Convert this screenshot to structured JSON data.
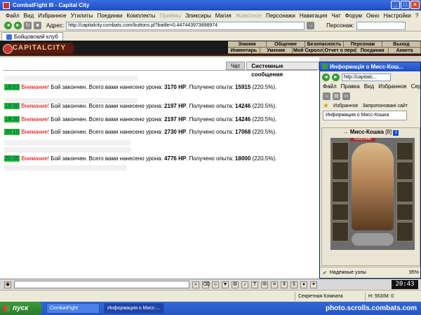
{
  "window": {
    "title": "CombatFight III - Capital City"
  },
  "menu": [
    "Файл",
    "Вид",
    "Избранное",
    "Утилиты",
    "Поединки",
    "Комплекты",
    "Приёмы",
    "Эликсиры",
    "Магия",
    "Животное",
    "Персонажи",
    "Навигация",
    "Чат",
    "Форум",
    "Окно",
    "Настройки",
    "?"
  ],
  "address": {
    "label": "Адрес:",
    "url": "http://capitalcity.combats.com/buttons.pl?battle=0.447443973898974",
    "persona_label": "Персонаж:"
  },
  "tab": {
    "label": "Бойцовский клуб"
  },
  "game": {
    "logo": "CAPITALCITY",
    "menu_row1": [
      "Знания",
      "Общение",
      "Безопасность",
      "Персонаж",
      "Выход"
    ],
    "menu_row2": [
      "Инвентарь",
      "Умения",
      "Мой Скролл",
      "Отчет о переводах",
      "Поединки",
      "Анкета"
    ]
  },
  "chat": {
    "tabs": [
      "Чат",
      "Системные сообщения"
    ],
    "messages": [
      {
        "time": "19:03",
        "warn": "Внимание!",
        "text1": " Бой закончен. Всего вами нанесено урона: ",
        "damage": "3170 HP",
        "text2": ". Получено опыта: ",
        "exp": "15915",
        "pct": " (220.5%)."
      },
      {
        "time": "19:30",
        "warn": "Внимание!",
        "text1": " Бой закончен. Всего вами нанесено урона: ",
        "damage": "2197 HP",
        "text2": ". Получено опыта: ",
        "exp": "14246",
        "pct": " (220.5%)."
      },
      {
        "time": "19:30",
        "warn": "Внимание!",
        "text1": " Бой закончен. Всего вами нанесено урона: ",
        "damage": "2197 HP",
        "text2": ". Получено опыта: ",
        "exp": "14246",
        "pct": " (220.5%)."
      },
      {
        "time": "20:10",
        "warn": "Внимание!",
        "text1": " Бой закончен. Всего вами нанесено урона: ",
        "damage": "2730 HP",
        "text2": ". Получено опыта: ",
        "exp": "17068",
        "pct": " (220.5%)."
      },
      {
        "time": "20:35",
        "warn": "Внимание!",
        "text1": " Бой закончен. Всего вами нанесено урона: ",
        "damage": "4776 HP",
        "text2": ". Получено опыта: ",
        "exp": "18000",
        "pct": " (220.5%)."
      }
    ]
  },
  "popup": {
    "title": "Информація о Мисс-Кош...",
    "url": "http://capitalc...",
    "menu": [
      "Файл",
      "Правка",
      "Вид",
      "Избранное",
      "Сервис"
    ],
    "favorites": "Избранное",
    "suggested": "Запропоновані сайт",
    "tab": "Информация о Мисс-Кошка",
    "char_name": "Мисс-Кошка",
    "level": "[8]",
    "hp": "5320/1446",
    "zone": "Надежные узлы",
    "zoom": "95%"
  },
  "bottombar": {
    "clock": "20:43"
  },
  "statusbar": {
    "room": "Секретная Комната",
    "hp": "Н: 553/М: 0"
  },
  "taskbar": {
    "start": "пуск",
    "items": [
      "CombatFight",
      "Информация о Мисс-..."
    ],
    "watermark": "photo.scrolls.combats.com"
  }
}
